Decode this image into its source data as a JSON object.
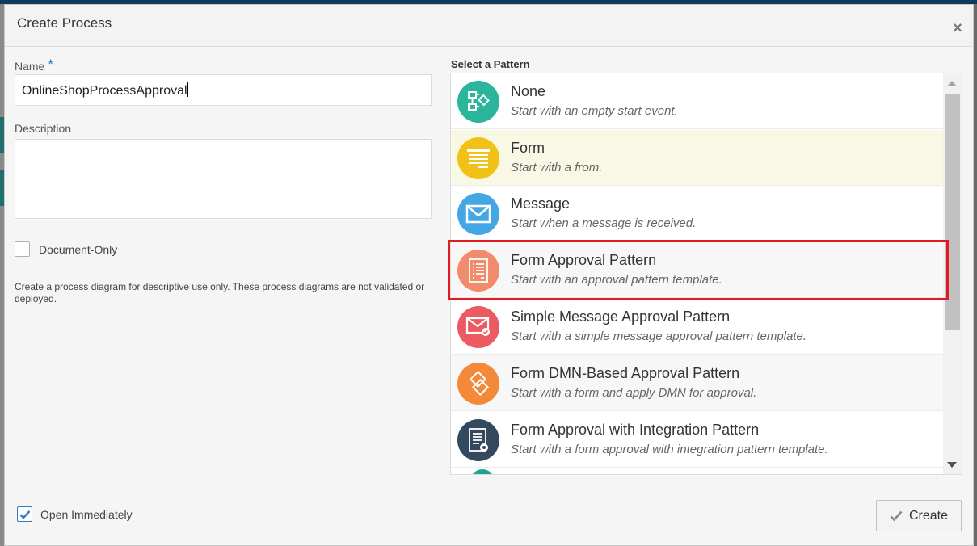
{
  "dialog": {
    "title": "Create Process",
    "close_glyph": "×"
  },
  "form": {
    "name_label": "Name",
    "required_marker": "*",
    "name_value": "OnlineShopProcessApproval",
    "description_label": "Description",
    "description_value": "",
    "document_only_label": "Document-Only",
    "document_only_checked": false,
    "help_text": "Create a process diagram for descriptive use only. These process diagrams are not validated or deployed.",
    "open_immediately_label": "Open Immediately",
    "open_immediately_checked": true
  },
  "patterns": {
    "label": "Select a Pattern",
    "items": [
      {
        "title": "None",
        "subtitle": "Start with an empty start event.",
        "icon": "flow-diagram-icon",
        "color": "#2bb59b"
      },
      {
        "title": "Form",
        "subtitle": "Start with a from.",
        "icon": "form-icon",
        "color": "#f2c115"
      },
      {
        "title": "Message",
        "subtitle": "Start when a message is received.",
        "icon": "envelope-icon",
        "color": "#43a7e6"
      },
      {
        "title": "Form Approval Pattern",
        "subtitle": "Start with an approval pattern template.",
        "icon": "form-approval-icon",
        "color": "#f28a6c"
      },
      {
        "title": "Simple Message Approval Pattern",
        "subtitle": "Start with a simple message approval pattern template.",
        "icon": "message-approval-icon",
        "color": "#ec5b61"
      },
      {
        "title": "Form DMN-Based Approval Pattern",
        "subtitle": "Start with a form and apply DMN for approval.",
        "icon": "dmn-icon",
        "color": "#f5893a"
      },
      {
        "title": "Form Approval with Integration Pattern",
        "subtitle": "Start with a form approval with integration pattern template.",
        "icon": "integration-icon",
        "color": "#34495e"
      }
    ],
    "hover_index": 1,
    "highlighted_index": 3
  },
  "actions": {
    "create_label": "Create"
  },
  "colors": {
    "accent": "#1f74c8",
    "highlight": "#e01b24"
  }
}
